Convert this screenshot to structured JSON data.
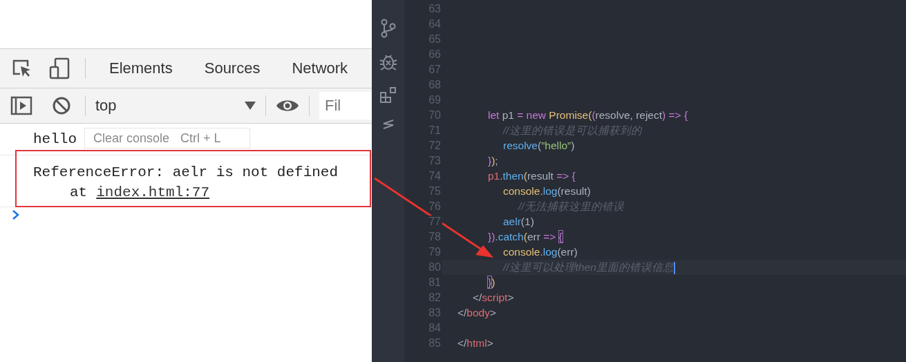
{
  "devtools": {
    "tabs": [
      {
        "label": "Elements",
        "selected": false
      },
      {
        "label": "Sources",
        "selected": false
      },
      {
        "label": "Network",
        "selected": false
      }
    ],
    "context": "top",
    "filter": {
      "placeholder": "Fil"
    },
    "tooltip": {
      "label": "Clear console",
      "shortcut": "Ctrl + L"
    },
    "console": [
      {
        "kind": "log",
        "text": "hello"
      },
      {
        "kind": "error",
        "text": "ReferenceError: aelr is not defined",
        "prefix": "at",
        "link": "index.html:77"
      }
    ]
  },
  "editor": {
    "lines": [
      {
        "number": "63",
        "active": false
      },
      {
        "number": "64",
        "active": false
      },
      {
        "number": "65",
        "active": false
      },
      {
        "number": "66",
        "active": false
      },
      {
        "number": "67",
        "active": false
      },
      {
        "number": "68",
        "active": false
      },
      {
        "number": "69",
        "active": false
      },
      {
        "number": "70",
        "active": false,
        "tokens": [
          {
            "text": "        let",
            "kind": "keyword"
          },
          {
            "text": " p1 ",
            "kind": "plain"
          },
          {
            "text": "=",
            "kind": "keyword"
          },
          {
            "text": " new ",
            "kind": "keyword"
          },
          {
            "text": "Promise",
            "kind": "class"
          },
          {
            "text": "(",
            "kind": "paren"
          },
          {
            "text": "(",
            "kind": "bracket"
          },
          {
            "text": "resolve, reject",
            "kind": "plain"
          },
          {
            "text": ") ",
            "kind": "bracket"
          },
          {
            "text": "=> {",
            "kind": "keyword"
          }
        ]
      },
      {
        "number": "71",
        "active": false,
        "tokens": [
          {
            "text": "            //这里的错误是可以捕获到的",
            "kind": "comment"
          }
        ]
      },
      {
        "number": "72",
        "active": false,
        "tokens": [
          {
            "text": "            resolve",
            "kind": "func"
          },
          {
            "text": "(",
            "kind": "plain"
          },
          {
            "text": "”hello”",
            "kind": "string"
          },
          {
            "text": ")",
            "kind": "plain"
          }
        ]
      },
      {
        "number": "73",
        "active": false,
        "tokens": [
          {
            "text": "        }",
            "kind": "keyword"
          },
          {
            "text": ")",
            "kind": "paren"
          },
          {
            "text": ";",
            "kind": "plain"
          }
        ]
      },
      {
        "number": "74",
        "active": false,
        "tokens": [
          {
            "text": "        p1",
            "kind": "variable"
          },
          {
            "text": ".",
            "kind": "plain"
          },
          {
            "text": "then",
            "kind": "func"
          },
          {
            "text": "(",
            "kind": "paren"
          },
          {
            "text": "result ",
            "kind": "plain"
          },
          {
            "text": "=> {",
            "kind": "keyword"
          }
        ]
      },
      {
        "number": "75",
        "active": false,
        "tokens": [
          {
            "text": "            console",
            "kind": "class"
          },
          {
            "text": ".",
            "kind": "plain"
          },
          {
            "text": "log",
            "kind": "func"
          },
          {
            "text": "(result)",
            "kind": "plain"
          }
        ]
      },
      {
        "number": "76",
        "active": false,
        "tokens": [
          {
            "text": "                //无法捕获这里的错误",
            "kind": "comment"
          }
        ]
      },
      {
        "number": "77",
        "active": false,
        "tokens": [
          {
            "text": "            aelr",
            "kind": "func"
          },
          {
            "text": "(1)",
            "kind": "plain"
          }
        ]
      },
      {
        "number": "78",
        "active": false,
        "tokens": [
          {
            "text": "        })",
            "kind": "keyword"
          },
          {
            "text": ".",
            "kind": "plain"
          },
          {
            "text": "catch",
            "kind": "func"
          },
          {
            "text": "(",
            "kind": "paren"
          },
          {
            "text": "err ",
            "kind": "plain"
          },
          {
            "text": "=> ",
            "kind": "keyword"
          },
          {
            "text": "{",
            "kind": "match"
          }
        ]
      },
      {
        "number": "79",
        "active": false,
        "tokens": [
          {
            "text": "            console",
            "kind": "class"
          },
          {
            "text": ".",
            "kind": "plain"
          },
          {
            "text": "log",
            "kind": "func"
          },
          {
            "text": "(err)",
            "kind": "plain"
          }
        ]
      },
      {
        "number": "80",
        "active": true,
        "tokens": [
          {
            "text": "            //这里可以处理then里面的错误信息",
            "kind": "comment"
          }
        ]
      },
      {
        "number": "81",
        "active": false,
        "tokens": [
          {
            "text": "        }",
            "kind": "match"
          },
          {
            "text": ")",
            "kind": "paren"
          }
        ]
      },
      {
        "number": "82",
        "active": false,
        "tokens": [
          {
            "text": "    </",
            "kind": "plain"
          },
          {
            "text": "script",
            "kind": "tag"
          },
          {
            "text": ">",
            "kind": "plain"
          }
        ]
      },
      {
        "number": "83",
        "active": false,
        "tokens": [
          {
            "text": "</",
            "kind": "plain"
          },
          {
            "text": "body",
            "kind": "tag"
          },
          {
            "text": ">",
            "kind": "plain"
          }
        ]
      },
      {
        "number": "84",
        "active": false
      },
      {
        "number": "85",
        "active": false,
        "tokens": [
          {
            "text": "</",
            "kind": "plain"
          },
          {
            "text": "html",
            "kind": "tag"
          },
          {
            "text": ">",
            "kind": "plain"
          }
        ]
      }
    ]
  }
}
